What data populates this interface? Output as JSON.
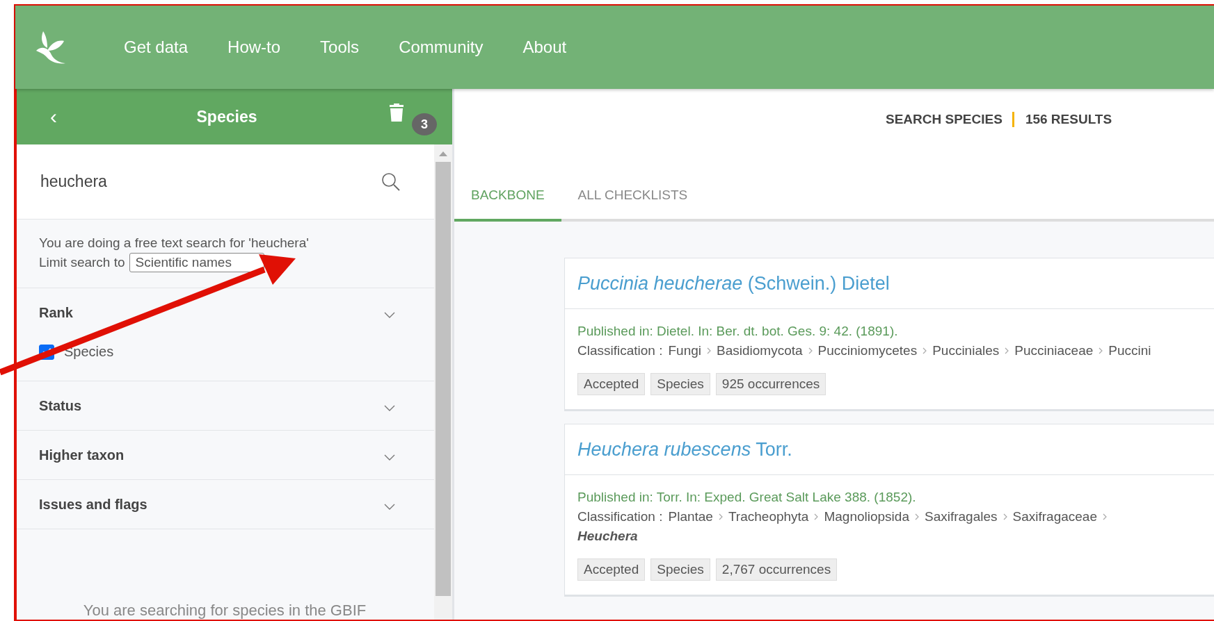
{
  "nav": {
    "items": [
      "Get data",
      "How-to",
      "Tools",
      "Community",
      "About"
    ]
  },
  "sidebar": {
    "back": "‹",
    "title": "Species",
    "clear_count": "3",
    "search": {
      "value": "heuchera"
    },
    "notice": "You are doing a free text search for 'heuchera'",
    "limit_label": "Limit search to",
    "limit_value": "Scientific names",
    "sections": [
      {
        "title": "Rank",
        "options": [
          {
            "label": "Species",
            "checked": true
          }
        ]
      },
      {
        "title": "Status"
      },
      {
        "title": "Higher taxon"
      },
      {
        "title": "Issues and flags"
      }
    ],
    "footer": "You are searching for species in the GBIF"
  },
  "main": {
    "heading": "SEARCH SPECIES",
    "count": "156 RESULTS",
    "tabs": [
      {
        "label": "BACKBONE",
        "selected": true
      },
      {
        "label": "ALL CHECKLISTS",
        "selected": false
      }
    ],
    "results": [
      {
        "title": "*Puccinia heucherae* (Schwein.) Dietel",
        "published": "Published in: Dietel. In: Ber. dt. bot. Ges. 9: 42. (1891).",
        "classification_label": "Classification :",
        "classification": [
          {
            "name": "Fungi",
            "kind": "rank"
          },
          {
            "name": "Basidiomycota",
            "kind": "rank"
          },
          {
            "name": "Pucciniomycetes",
            "kind": "rank"
          },
          {
            "name": "Pucciniales",
            "kind": "rank"
          },
          {
            "name": "Pucciniaceae",
            "kind": "rank"
          },
          {
            "name": "Puccini",
            "kind": "rank"
          }
        ],
        "tags": [
          "Accepted",
          "Species",
          "925 occurrences"
        ]
      },
      {
        "title": "*Heuchera rubescens* Torr.",
        "published": "Published in: Torr. In: Exped. Great Salt Lake 388. (1852).",
        "classification_label": "Classification :",
        "classification": [
          {
            "name": "Plantae",
            "kind": "rank"
          },
          {
            "name": "Tracheophyta",
            "kind": "rank"
          },
          {
            "name": "Magnoliopsida",
            "kind": "rank"
          },
          {
            "name": "Saxifragales",
            "kind": "rank"
          },
          {
            "name": "Saxifragaceae",
            "kind": "rank"
          },
          {
            "name": "Heuchera",
            "kind": "genus"
          }
        ],
        "tags": [
          "Accepted",
          "Species",
          "2,767 occurrences"
        ]
      }
    ]
  }
}
